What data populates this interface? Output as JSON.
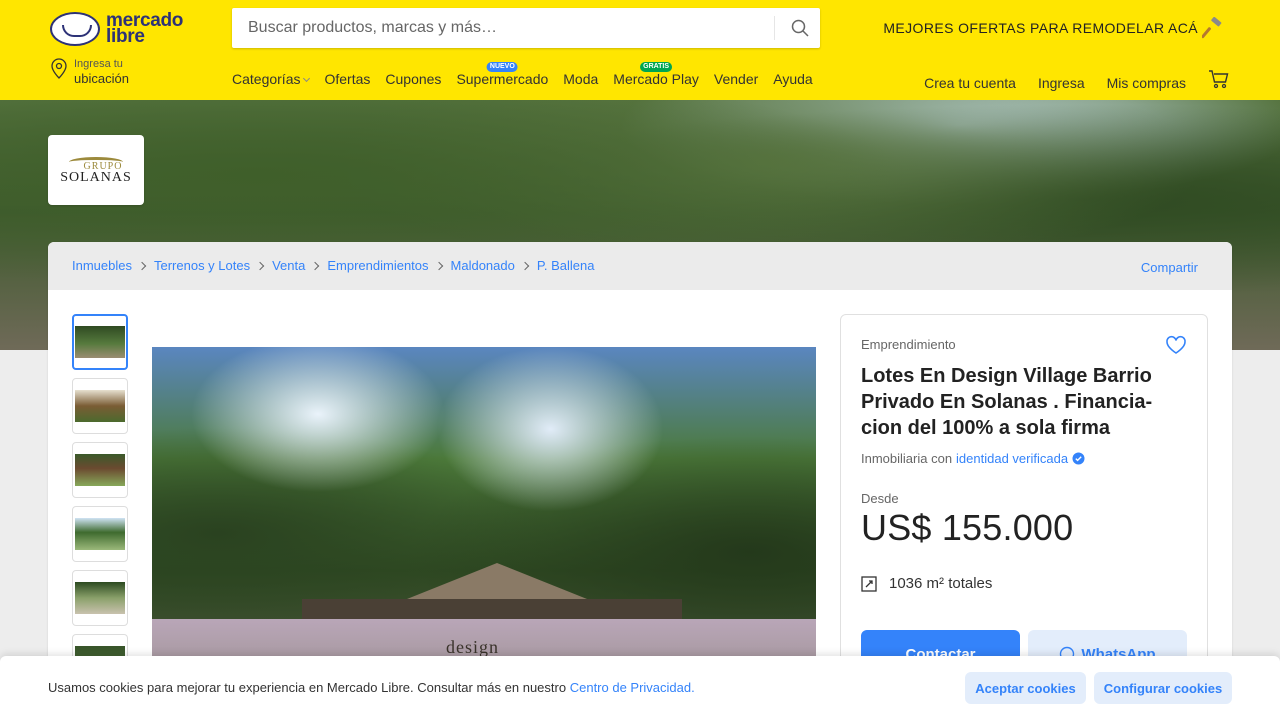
{
  "header": {
    "logo_text": "mercado libre",
    "search_placeholder": "Buscar productos, marcas y más…",
    "promo_text": "MEJORES OFERTAS PARA REMODELAR ACÁ",
    "location": {
      "small": "Ingresa tu",
      "big": "ubicación"
    },
    "nav": [
      {
        "label": "Categorías",
        "tag": ""
      },
      {
        "label": "Ofertas",
        "tag": ""
      },
      {
        "label": "Cupones",
        "tag": ""
      },
      {
        "label": "Supermercado",
        "tag": "NUEVO"
      },
      {
        "label": "Moda",
        "tag": ""
      },
      {
        "label": "Mercado Play",
        "tag": "GRATIS"
      },
      {
        "label": "Vender",
        "tag": ""
      },
      {
        "label": "Ayuda",
        "tag": ""
      }
    ],
    "account": {
      "create": "Crea tu cuenta",
      "login": "Ingresa",
      "purchases": "Mis compras"
    }
  },
  "brand": {
    "line1": "GRUPO",
    "line2": "SOLANAS"
  },
  "breadcrumb": [
    "Inmuebles",
    "Terrenos y Lotes",
    "Venta",
    "Emprendimientos",
    "Maldonado",
    "P. Ballena"
  ],
  "share_label": "Compartir",
  "listing": {
    "type": "Emprendimiento",
    "title": "Lotes En Design Village Barrio Privado En Solanas . Financia-cion del 100% a sola firma",
    "seller_prefix": "Inmobiliaria con",
    "seller_link": "identidad verificada",
    "price_from": "Desde",
    "price": "US$ 155.000",
    "area_value": "1036 m²",
    "area_suffix": "totales",
    "contact_label": "Contactar",
    "whatsapp_label": "WhatsApp",
    "photo_sign": "design"
  },
  "cookie": {
    "message": "Usamos cookies para mejorar tu experiencia en Mercado Libre. Consultar más en nuestro",
    "link": "Centro de Privacidad.",
    "accept": "Aceptar cookies",
    "configure": "Configurar cookies"
  },
  "colors": {
    "header_bg": "#ffe600",
    "accent": "#3483fa",
    "tag_blue": "#3483fa",
    "tag_green": "#00a650"
  }
}
